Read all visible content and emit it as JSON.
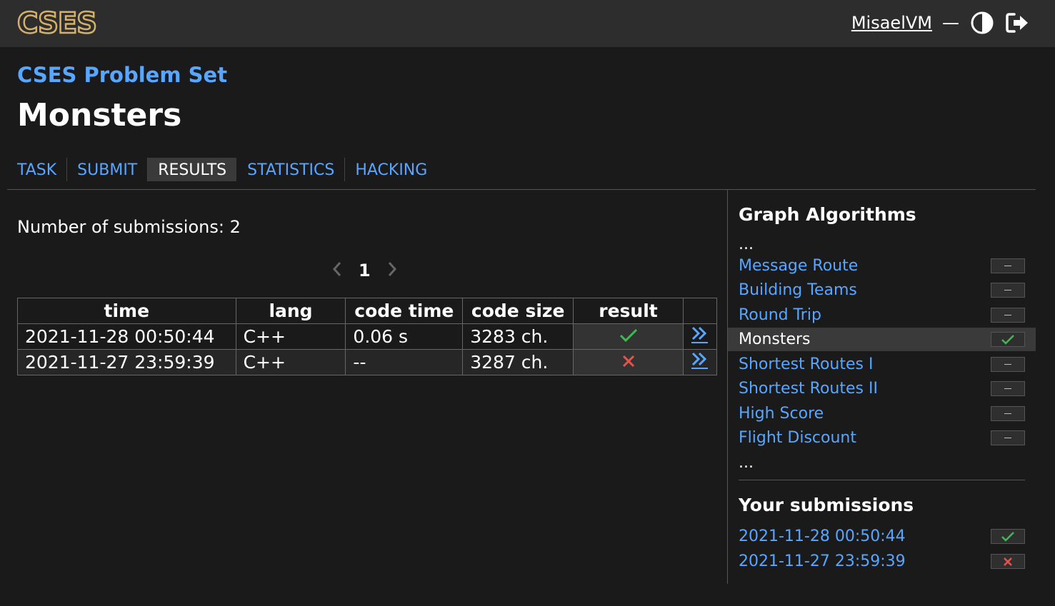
{
  "header": {
    "logo_text": "CSES",
    "username": "MisaelVM",
    "separator": "—",
    "theme_icon": "contrast-icon",
    "logout_icon": "logout-icon"
  },
  "page": {
    "problemset_title": "CSES Problem Set",
    "task_title": "Monsters"
  },
  "tabs": [
    {
      "label": "TASK"
    },
    {
      "label": "SUBMIT"
    },
    {
      "label": "RESULTS",
      "active": true
    },
    {
      "label": "STATISTICS"
    },
    {
      "label": "HACKING"
    }
  ],
  "results": {
    "count_text": "Number of submissions: 2",
    "pager": {
      "current_page": "1"
    },
    "columns": [
      "time",
      "lang",
      "code time",
      "code size",
      "result",
      ""
    ],
    "rows": [
      {
        "time": "2021-11-28 00:50:44",
        "lang": "C++",
        "code_time": "0.06 s",
        "code_size": "3283 ch.",
        "result": "accepted"
      },
      {
        "time": "2021-11-27 23:59:39",
        "lang": "C++",
        "code_time": "--",
        "code_size": "3287 ch.",
        "result": "rejected"
      }
    ]
  },
  "sidebar": {
    "section_title": "Graph Algorithms",
    "ellipsis": "...",
    "tasks": [
      {
        "label": "Message Route",
        "status": "none"
      },
      {
        "label": "Building Teams",
        "status": "none"
      },
      {
        "label": "Round Trip",
        "status": "none"
      },
      {
        "label": "Monsters",
        "status": "accepted",
        "current": true
      },
      {
        "label": "Shortest Routes I",
        "status": "none"
      },
      {
        "label": "Shortest Routes II",
        "status": "none"
      },
      {
        "label": "High Score",
        "status": "none"
      },
      {
        "label": "Flight Discount",
        "status": "none"
      }
    ],
    "submissions_title": "Your submissions",
    "submissions": [
      {
        "label": "2021-11-28 00:50:44",
        "status": "accepted"
      },
      {
        "label": "2021-11-27 23:59:39",
        "status": "rejected"
      }
    ]
  },
  "colors": {
    "link": "#58a6ff",
    "accepted": "#3fb950",
    "rejected": "#e5534b",
    "logo_gold": "#d4b068"
  }
}
